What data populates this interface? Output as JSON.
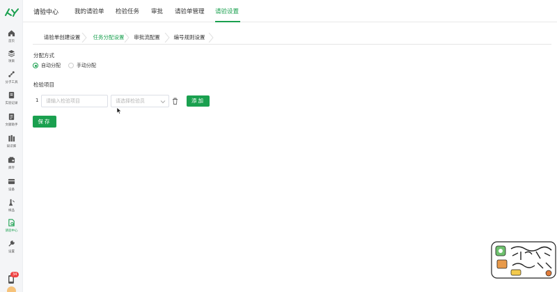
{
  "sidebar": {
    "logo_icon": "ky-logo-icon",
    "items": [
      {
        "label": "首页",
        "icon": "home-icon"
      },
      {
        "label": "项目",
        "icon": "layers-icon"
      },
      {
        "label": "分子工具",
        "icon": "molecule-icon"
      },
      {
        "label": "实验记录",
        "icon": "notebook-icon"
      },
      {
        "label": "文献助手",
        "icon": "document-icon"
      },
      {
        "label": "知识库",
        "icon": "library-icon"
      },
      {
        "label": "库存",
        "icon": "inventory-icon"
      },
      {
        "label": "设备",
        "icon": "device-icon"
      },
      {
        "label": "样品",
        "icon": "sample-icon"
      },
      {
        "label": "请验中心",
        "icon": "inspection-icon"
      },
      {
        "label": "设置",
        "icon": "wrench-icon"
      }
    ],
    "active_index": 9,
    "notification_count": "34"
  },
  "topnav": {
    "brand": "请验中心",
    "items": [
      {
        "label": "我的请验单"
      },
      {
        "label": "检验任务"
      },
      {
        "label": "审批"
      },
      {
        "label": "请验单管理"
      },
      {
        "label": "请验设置"
      }
    ],
    "active": "请验设置"
  },
  "subtabs": {
    "items": [
      {
        "label": "请验单创建设置"
      },
      {
        "label": "任务分配设置"
      },
      {
        "label": "审批流配置"
      },
      {
        "label": "编号规则设置"
      }
    ],
    "active": "任务分配设置"
  },
  "assignment": {
    "title": "分配方式",
    "options": [
      {
        "label": "自动分配",
        "checked": true
      },
      {
        "label": "手动分配",
        "checked": false
      }
    ]
  },
  "inspection": {
    "title": "检验项目",
    "rows": [
      {
        "index": "1",
        "item_placeholder": "请输入检验项目",
        "group_placeholder": "请选择检验员"
      }
    ],
    "add_label": "添加"
  },
  "save_label": "保存",
  "colors": {
    "primary": "#1aa04f",
    "sidebar_bg": "#f4f5f7",
    "badge": "#ef4444"
  }
}
